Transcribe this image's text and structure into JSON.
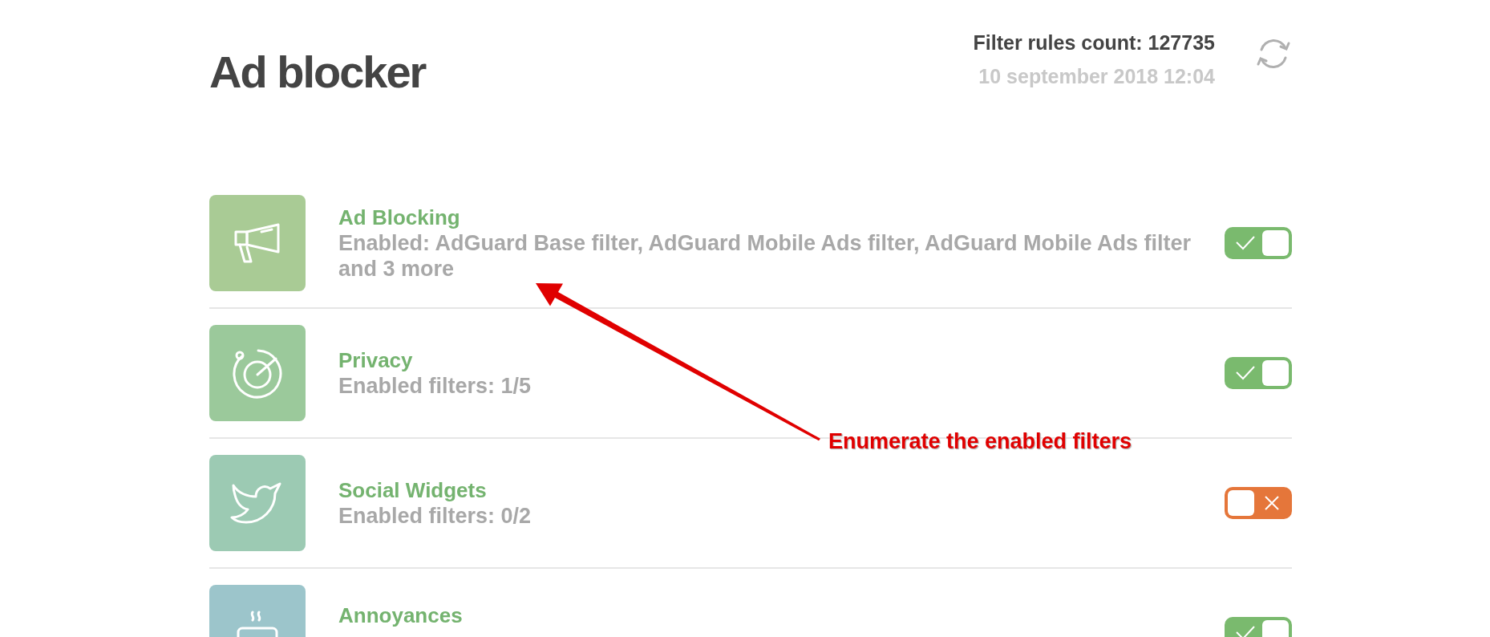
{
  "title": "Ad blocker",
  "stats": {
    "rules_count": "Filter rules count: 127735",
    "updated": "10 september 2018 12:04"
  },
  "groups": [
    {
      "kind": "megaphone",
      "name": "Ad Blocking",
      "summary": "Enabled: AdGuard Base filter, AdGuard Mobile Ads filter, AdGuard Mobile Ads filter and 3 more",
      "on": true,
      "color": "#a9cb95"
    },
    {
      "kind": "target",
      "name": "Privacy",
      "summary": "Enabled filters: 1/5",
      "on": true,
      "color": "#9bc99b"
    },
    {
      "kind": "bird",
      "name": "Social Widgets",
      "summary": "Enabled filters: 0/2",
      "on": false,
      "color": "#9ccab3"
    },
    {
      "kind": "tv",
      "name": "Annoyances",
      "on": true,
      "color": "#9cc5cb"
    }
  ],
  "annotation": {
    "text": "Enumerate the enabled filters"
  }
}
